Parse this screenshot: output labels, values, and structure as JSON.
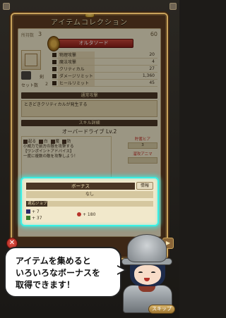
{
  "screen": {
    "title": "アイテムコレクション",
    "owned_label": "所持数",
    "owned_left": "3",
    "owned_right": "60"
  },
  "item": {
    "name": "オルタソード",
    "weapon_type": "剣",
    "set_label": "セット数",
    "set_value": "2"
  },
  "stats": [
    {
      "name": "物理攻撃",
      "value": "20"
    },
    {
      "name": "魔法攻撃",
      "value": "4"
    },
    {
      "name": "クリティカル",
      "value": "27"
    },
    {
      "name": "ダメージリミット",
      "value": "1,360"
    },
    {
      "name": "ヒールリミット",
      "value": "45"
    }
  ],
  "normal_attack": {
    "header": "通常攻撃",
    "description": "ときどきクリティカルが発生する"
  },
  "skill": {
    "header": "スキル詳細",
    "name": "オーバードライブ Lv.2",
    "tags": [
      "起る",
      "白",
      "魔",
      "防"
    ],
    "description": "小威力で前方の敵を攻撃する\n【ワンポイントアドバイス】\n一度に複数の敵を攻撃しよう！",
    "side_label_1": "貯蓄ヒア",
    "side_label_2": "溜攻アニマ",
    "side_value_1": "3",
    "side_value_2": ""
  },
  "bonus": {
    "header": "ボーナス",
    "info_button": "情報",
    "none_text": "なし",
    "job_label": "適応ジョブ",
    "values": [
      {
        "icon": "sword-icon",
        "value": "+ 7"
      },
      {
        "icon": "staff-icon",
        "value": "+ 37"
      },
      {
        "icon": "heart-icon",
        "value": "+ 180"
      }
    ]
  },
  "tutorial": {
    "message": "アイテムを集めると\nいろいろなボーナスを\n取得できます！",
    "skip_label": "スキップ"
  },
  "buttons": {
    "close": "✕",
    "next": "▶"
  },
  "colors": {
    "highlight": "#39f0e5",
    "banner": "#c74638"
  }
}
